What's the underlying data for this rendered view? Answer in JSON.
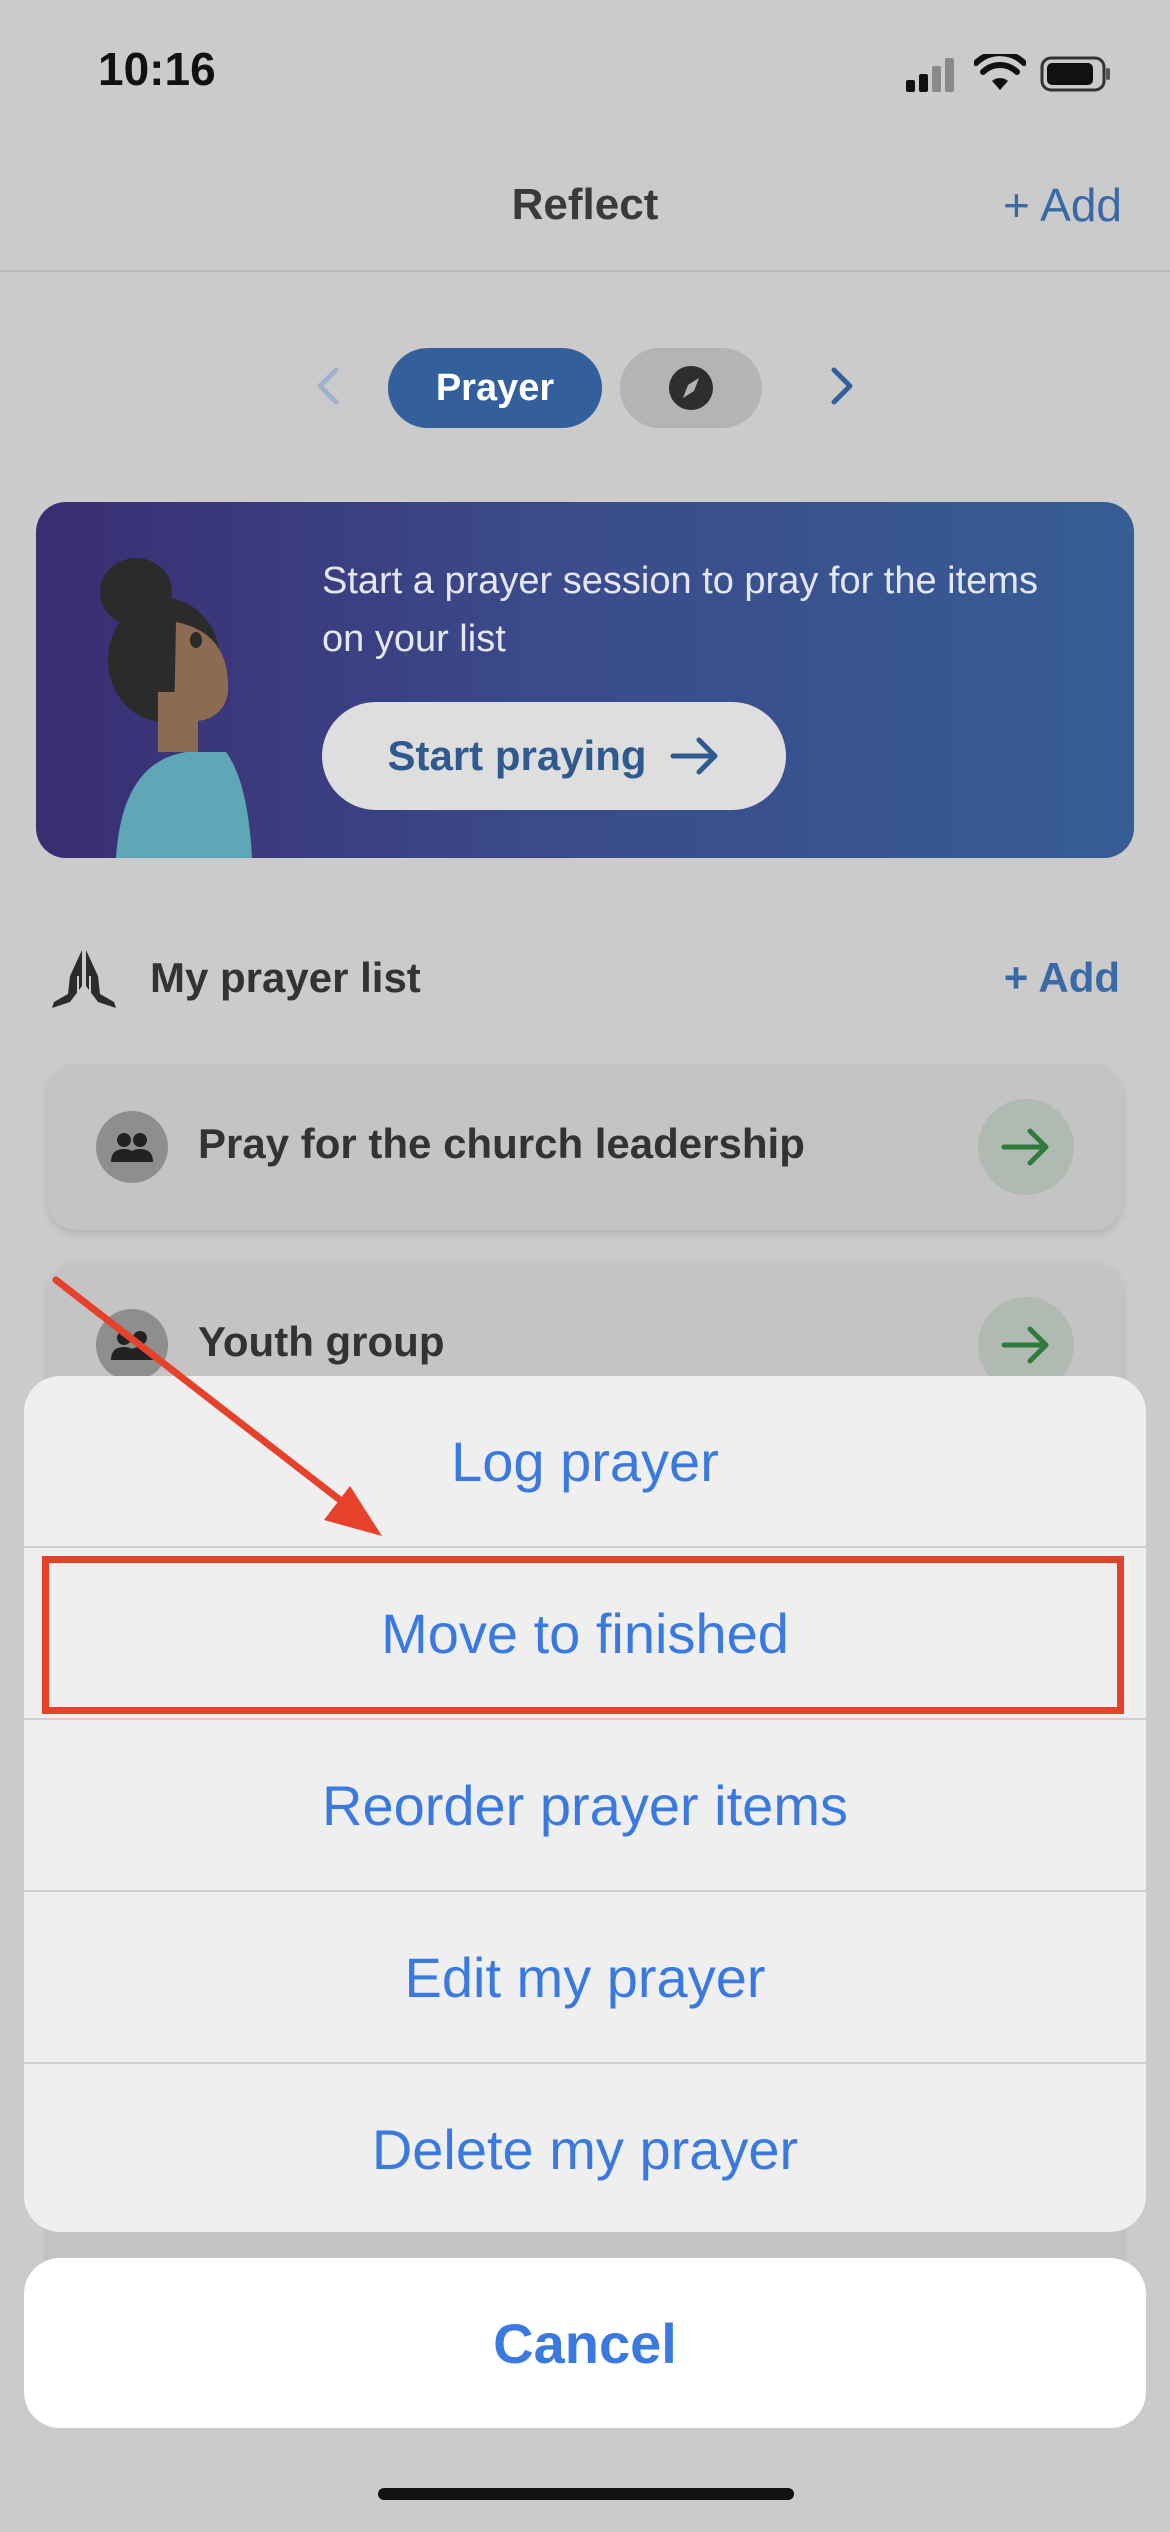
{
  "status_bar": {
    "time": "10:16"
  },
  "nav": {
    "title": "Reflect",
    "add_label": "+ Add"
  },
  "tabs": {
    "prayer_label": "Prayer",
    "explore_icon": "compass-icon"
  },
  "banner": {
    "text": "Start a prayer session to pray for the items on your list",
    "button_label": "Start praying"
  },
  "prayer_list": {
    "title": "My prayer list",
    "add_label": "+ Add",
    "items": [
      {
        "label": "Pray for the church leadership",
        "icon": "people-icon"
      },
      {
        "label": "Youth group",
        "icon": "people-icon"
      }
    ]
  },
  "action_sheet": {
    "items": [
      "Log prayer",
      "Move to finished",
      "Reorder prayer items",
      "Edit my prayer",
      "Delete my prayer"
    ],
    "cancel_label": "Cancel",
    "highlighted_item": "Move to finished"
  },
  "colors": {
    "accent": "#3a7ae0",
    "brand_blue": "#33609d",
    "annotation_red": "#e5412b",
    "go_arrow": "#2f7a3c"
  }
}
